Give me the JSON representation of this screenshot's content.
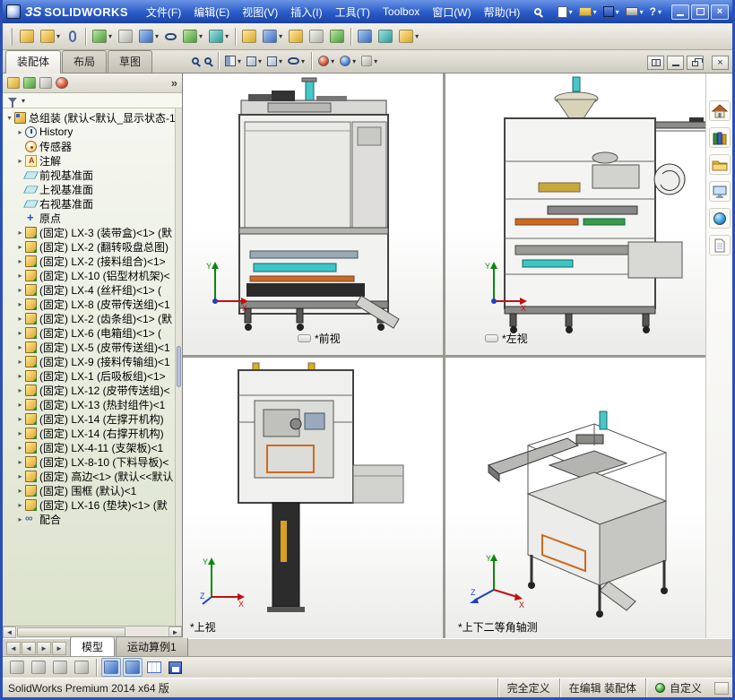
{
  "titlebar": {
    "logo": "3S",
    "brand": "SOLIDWORKS",
    "menus": [
      "文件(F)",
      "编辑(E)",
      "视图(V)",
      "插入(I)",
      "工具(T)",
      "Toolbox",
      "窗口(W)",
      "帮助(H)"
    ],
    "help_glyph": "?",
    "close_glyph": "×"
  },
  "command_tabs": {
    "assembly": "装配体",
    "layout": "布局",
    "sketch": "草图"
  },
  "panel": {
    "more": "»"
  },
  "tree": {
    "root": {
      "arrow": "▾",
      "label": "总组装 (默认<默认_显示状态-1"
    },
    "items": [
      {
        "arrow": "▸",
        "icon": "history",
        "label": "History"
      },
      {
        "arrow": "",
        "icon": "sensors",
        "label": "传感器"
      },
      {
        "arrow": "▸",
        "icon": "annotations",
        "label": "注解"
      },
      {
        "arrow": "",
        "icon": "plane",
        "label": "前视基准面"
      },
      {
        "arrow": "",
        "icon": "plane",
        "label": "上视基准面"
      },
      {
        "arrow": "",
        "icon": "plane",
        "label": "右视基准面"
      },
      {
        "arrow": "",
        "icon": "origin",
        "label": "原点"
      },
      {
        "arrow": "▸",
        "icon": "component",
        "label": "(固定) LX-3 (装带盒)<1> (默"
      },
      {
        "arrow": "▸",
        "icon": "component",
        "label": "(固定) LX-2 (翻转吸盘总图)"
      },
      {
        "arrow": "▸",
        "icon": "component",
        "label": "(固定) LX-2 (接料组合)<1>"
      },
      {
        "arrow": "▸",
        "icon": "component",
        "label": "(固定) LX-10 (铝型材机架)<"
      },
      {
        "arrow": "▸",
        "icon": "component",
        "label": "(固定) LX-4 (丝杆组)<1> ("
      },
      {
        "arrow": "▸",
        "icon": "component",
        "label": "(固定) LX-8 (皮带传送组)<1"
      },
      {
        "arrow": "▸",
        "icon": "component",
        "label": "(固定) LX-2 (齿条组)<1> (默"
      },
      {
        "arrow": "▸",
        "icon": "component",
        "label": "(固定) LX-6 (电箱组)<1> ("
      },
      {
        "arrow": "▸",
        "icon": "component",
        "label": "(固定) LX-5 (皮带传送组)<1"
      },
      {
        "arrow": "▸",
        "icon": "component",
        "label": "(固定) LX-9 (接料传输组)<1"
      },
      {
        "arrow": "▸",
        "icon": "component",
        "label": "(固定) LX-1 (后吸板组)<1>"
      },
      {
        "arrow": "▸",
        "icon": "component",
        "label": "(固定) LX-12 (皮带传送组)<"
      },
      {
        "arrow": "▸",
        "icon": "component",
        "label": "(固定) LX-13 (热封组件)<1"
      },
      {
        "arrow": "▸",
        "icon": "component",
        "label": "(固定) LX-14 (左撑开机构)"
      },
      {
        "arrow": "▸",
        "icon": "component",
        "label": "(固定) LX-14 (右撑开机构)"
      },
      {
        "arrow": "▸",
        "icon": "component",
        "label": "(固定) LX-4-11 (支架板)<1"
      },
      {
        "arrow": "▸",
        "icon": "component",
        "label": "(固定) LX-8-10 (下料导板)<"
      },
      {
        "arrow": "▸",
        "icon": "component",
        "label": "(固定) 高边<1> (默认<<默认"
      },
      {
        "arrow": "▸",
        "icon": "component",
        "label": "(固定) 围框 (默认)<1"
      },
      {
        "arrow": "▸",
        "icon": "component",
        "label": "(固定) LX-16 (垫块)<1> (默"
      },
      {
        "arrow": "▸",
        "icon": "mates",
        "label": "配合"
      }
    ]
  },
  "viewports": {
    "front": "*前视",
    "left": "*左视",
    "top": "*上视",
    "iso": "*上下二等角轴测"
  },
  "triad": {
    "x": "X",
    "y": "Y",
    "z": "Z"
  },
  "doc_tabs": {
    "nav": [
      "◄",
      "◄",
      "►",
      "►"
    ],
    "model": "模型",
    "motion": "运动算例1"
  },
  "statusbar": {
    "product": "SolidWorks Premium 2014 x64 版",
    "defined": "完全定义",
    "editing": "在编辑 装配体",
    "custom": "自定义"
  },
  "colors": {
    "titlebar_blue": "#2a5ac8",
    "toolbar_gray": "#d4d0c8",
    "accent_cyan": "#3ec6c6",
    "accent_orange": "#cc6a20",
    "accent_green": "#2e9a2e"
  }
}
